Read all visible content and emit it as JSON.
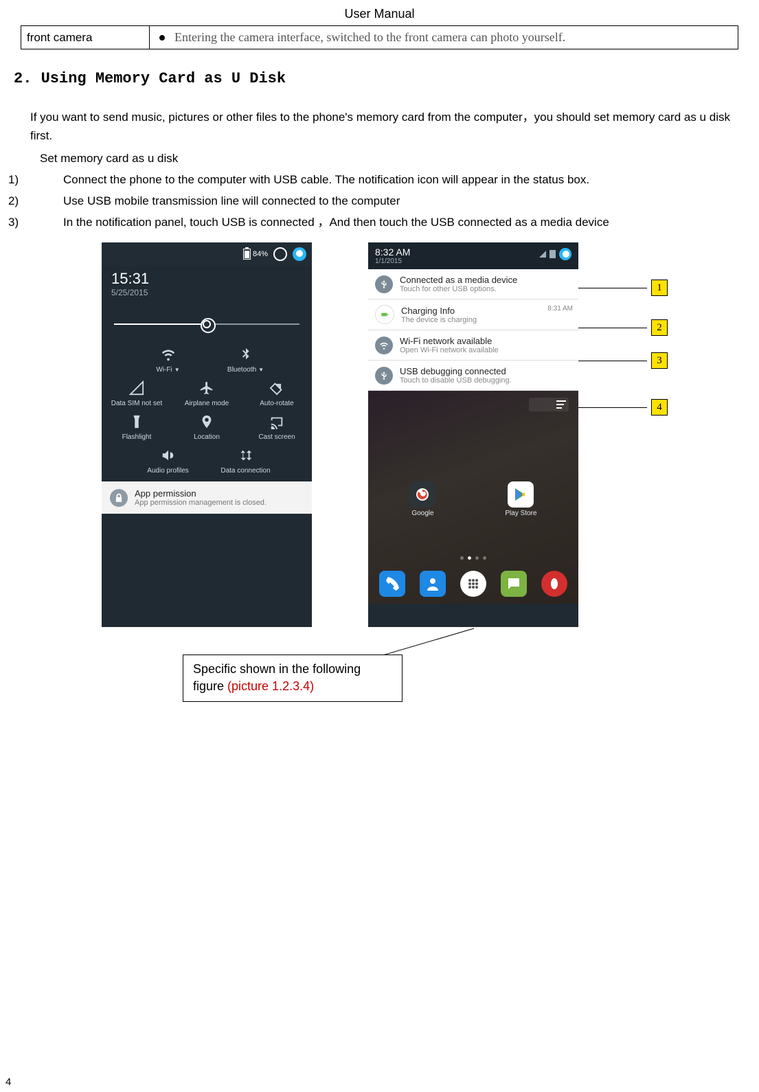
{
  "header": "User    Manual",
  "table": {
    "left": "front camera",
    "right": "Entering the camera interface, switched to the front camera can photo yourself."
  },
  "section_title": "2. Using Memory Card as U Disk",
  "intro": "If you want to send music, pictures or other files to the phone's memory card from the computer，you should set memory card as u disk first.",
  "sub": "Set memory card as u disk",
  "steps": [
    "Connect the phone to the computer with USB cable. The notification icon will appear in the status box.",
    "Use USB mobile transmission line will connected to the computer",
    "In the notification panel, touch USB is connected ，And then touch the USB connected as a media device"
  ],
  "phone_a": {
    "battery": "84%",
    "time": "15:31",
    "date": "5/25/2015",
    "tiles": {
      "wifi": "Wi-Fi",
      "bt": "Bluetooth",
      "sim": "Data SIM not set",
      "air": "Airplane mode",
      "rot": "Auto-rotate",
      "flash": "Flashlight",
      "loc": "Location",
      "cast": "Cast screen",
      "audio": "Audio profiles",
      "data": "Data connection"
    },
    "notif": {
      "title": "App permission",
      "sub": "App permission management is closed."
    }
  },
  "phone_b": {
    "time": "8:32 AM",
    "date": "1/1/2015",
    "n1": {
      "title": "Connected as a media device",
      "sub": "Touch for other USB options."
    },
    "n2": {
      "title": "Charging Info",
      "sub": "The device is charging",
      "ts": "8:31 AM"
    },
    "n3": {
      "title": "Wi-Fi network available",
      "sub": "Open Wi-Fi network available"
    },
    "n4": {
      "title": "USB debugging connected",
      "sub": "Touch to disable USB debugging."
    },
    "apps": {
      "google": "Google",
      "play": "Play Store"
    }
  },
  "callouts": [
    "1",
    "2",
    "3",
    "4"
  ],
  "caption": {
    "text": "Specific shown in the following figure   ",
    "red": "(picture 1.2.3.4)"
  },
  "page_number": "4"
}
